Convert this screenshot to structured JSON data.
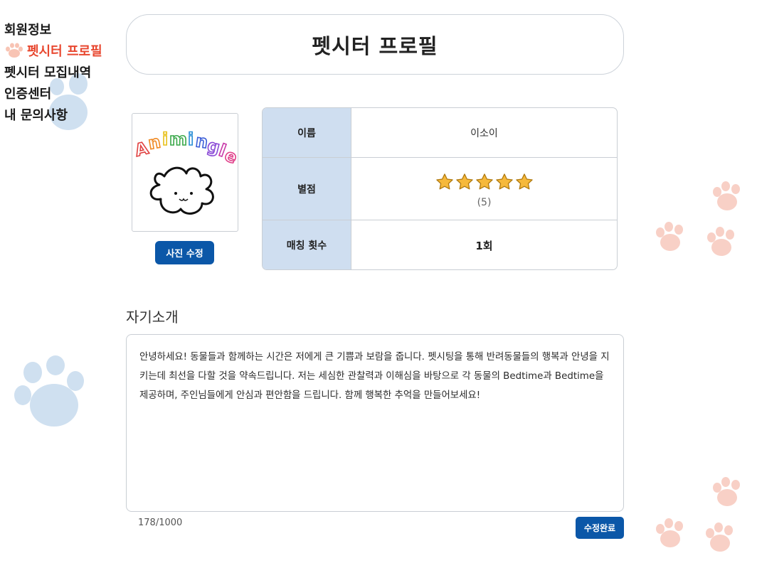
{
  "sidebar": {
    "items": [
      {
        "label": "회원정보",
        "active": false
      },
      {
        "label": "펫시터 프로필",
        "active": true
      },
      {
        "label": "펫시터 모집내역",
        "active": false
      },
      {
        "label": "인증센터",
        "active": false
      },
      {
        "label": "내 문의사항",
        "active": false
      }
    ]
  },
  "page": {
    "title": "펫시터 프로필"
  },
  "profile": {
    "photo_logo_text": "Animingle",
    "photo_edit_label": "사진 수정",
    "rows": {
      "name": {
        "label": "이름",
        "value": "이소이"
      },
      "rating": {
        "label": "별점",
        "stars": 5,
        "text": "(5)"
      },
      "count": {
        "label": "매칭 횟수",
        "value": "1회"
      }
    }
  },
  "intro": {
    "heading": "자기소개",
    "text": "안녕하세요! 동물들과 함께하는 시간은 저에게 큰 기쁨과 보람을 줍니다. 펫시팅을 통해 반려동물들의 행복과 안녕을 지키는데 최선을 다할 것을 약속드립니다. 저는 세심한 관찰력과 이해심을 바탕으로 각 동물의 Bedtime과 Bedtime을 제공하며, 주인님들에게 안심과 편안함을 드립니다. 함께 행복한 추억을 만들어보세요!",
    "char_count": "178/1000",
    "done_label": "수정완료"
  },
  "colors": {
    "accent": "#0b57a8",
    "active_nav": "#e8472f",
    "label_bg": "#cfdef0",
    "paw_blue": "#cfe0f0",
    "paw_pink": "#f8d0c6",
    "star": "#f6b93b"
  },
  "icons": {
    "nav_active": "paw-icon",
    "rating": "star-icon",
    "decoration": "paw-print-icon"
  }
}
